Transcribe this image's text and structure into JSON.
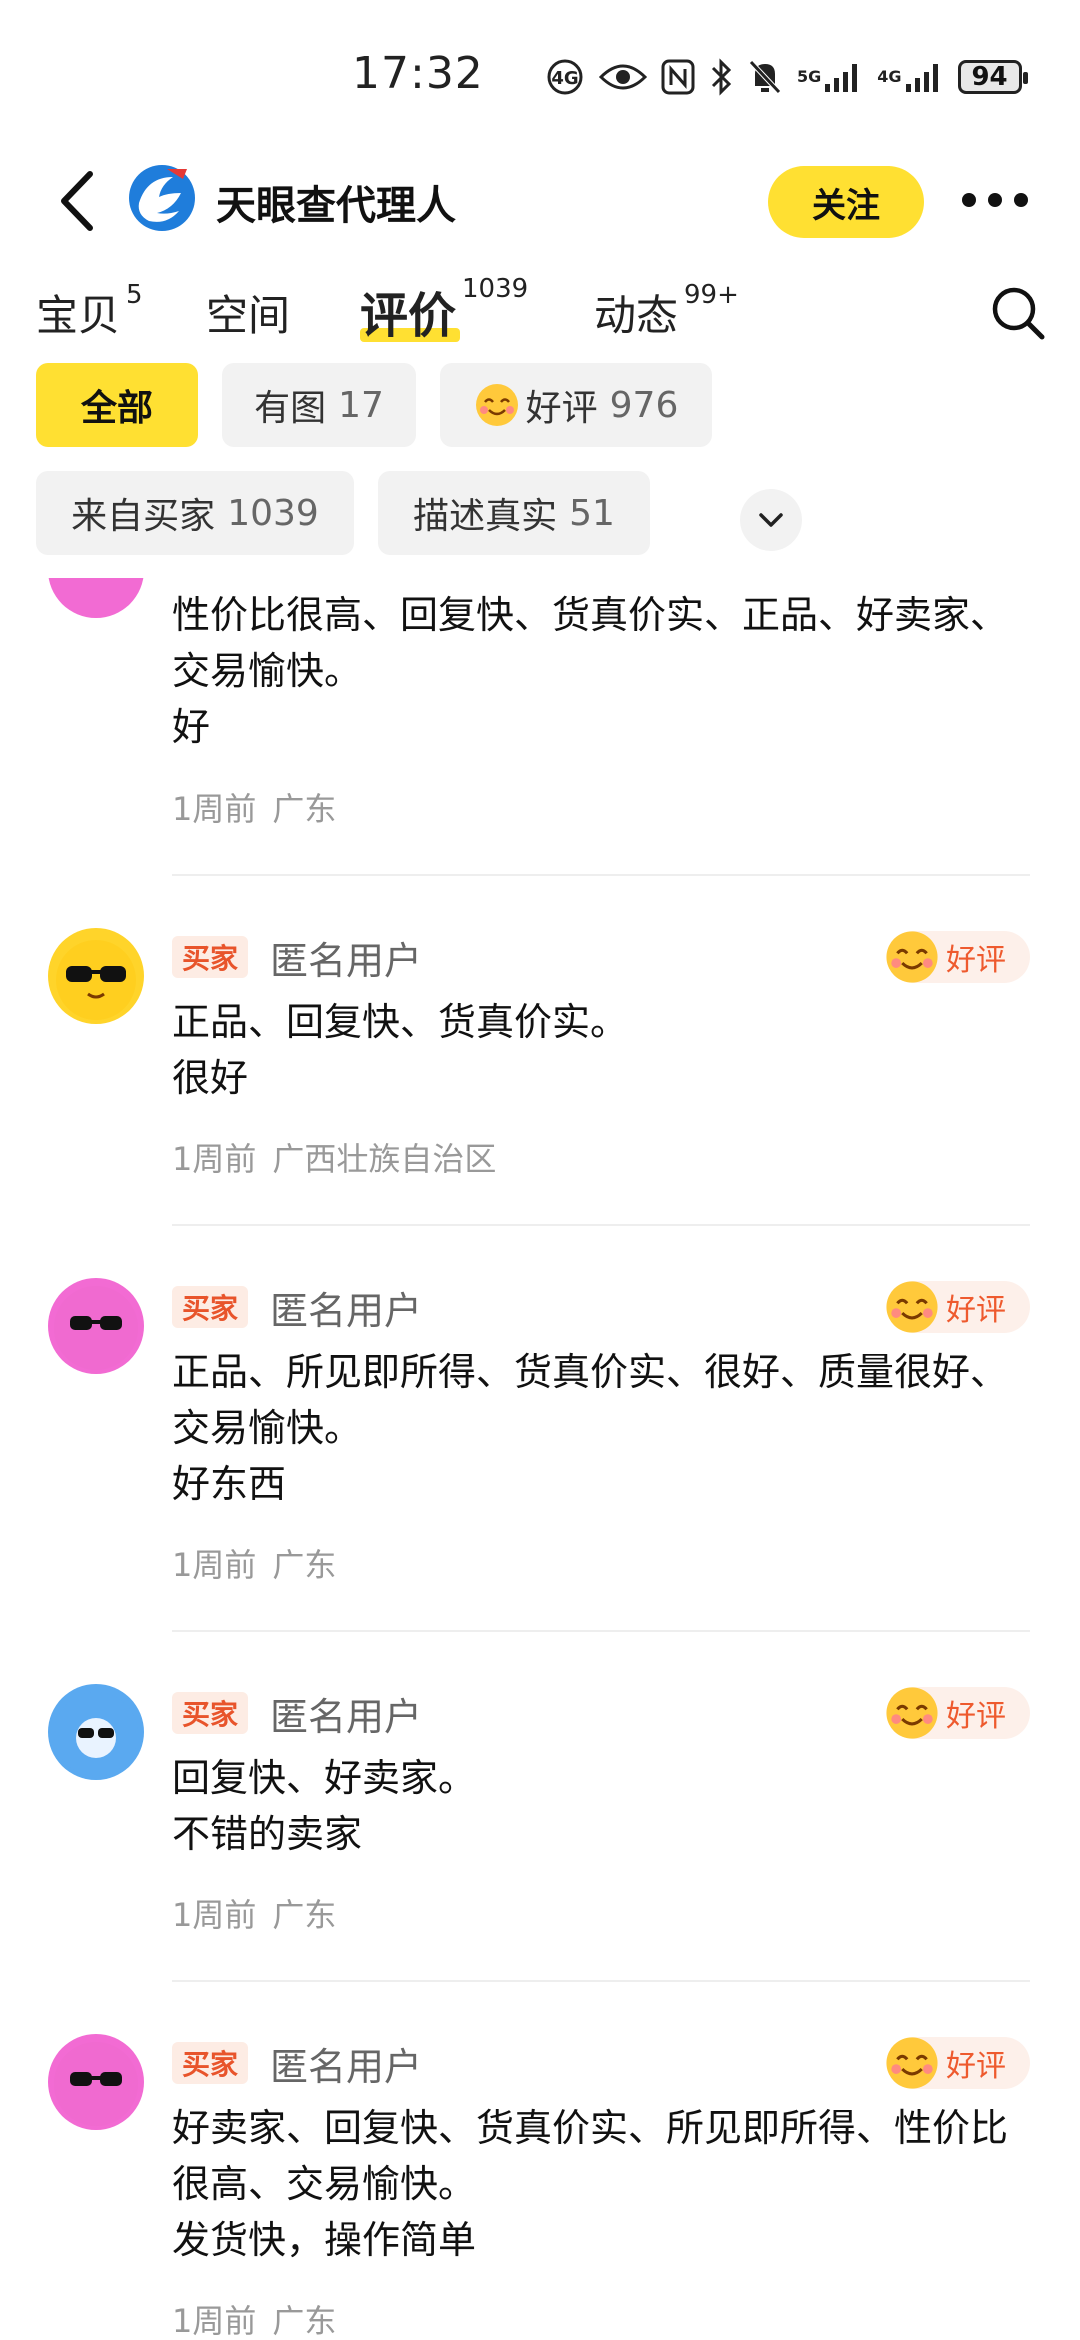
{
  "status_bar": {
    "time": "17:32",
    "battery": "94",
    "net1": "5G",
    "net2": "4G"
  },
  "header": {
    "shop_name": "天眼查代理人",
    "follow_label": "关注"
  },
  "tabs": [
    {
      "label": "宝贝",
      "count": "5"
    },
    {
      "label": "空间",
      "count": ""
    },
    {
      "label": "评价",
      "count": "1039"
    },
    {
      "label": "动态",
      "count": "99+"
    }
  ],
  "filters": [
    {
      "label": "全部",
      "count": ""
    },
    {
      "label": "有图",
      "count": "17"
    },
    {
      "label": "好评",
      "count": "976"
    },
    {
      "label": "来自买家",
      "count": "1039"
    },
    {
      "label": "描述真实",
      "count": "51"
    }
  ],
  "reviews": [
    {
      "tag": "",
      "user": "",
      "rating": "",
      "lines": [
        "性价比很高、回复快、货真价实、正品、好卖家、交易愉快。",
        "好"
      ],
      "time": "1周前",
      "location": "广东",
      "avatar_color": "#f26bd3"
    },
    {
      "tag": "买家",
      "user": "匿名用户",
      "rating": "好评",
      "lines": [
        "正品、回复快、货真价实。",
        "很好"
      ],
      "time": "1周前",
      "location": "广西壮族自治区",
      "avatar_color": "#ffd42a"
    },
    {
      "tag": "买家",
      "user": "匿名用户",
      "rating": "好评",
      "lines": [
        "正品、所见即所得、货真价实、很好、质量很好、交易愉快。",
        "好东西"
      ],
      "time": "1周前",
      "location": "广东",
      "avatar_color": "#f26bd3"
    },
    {
      "tag": "买家",
      "user": "匿名用户",
      "rating": "好评",
      "lines": [
        "回复快、好卖家。",
        "不错的卖家"
      ],
      "time": "1周前",
      "location": "广东",
      "avatar_color": "#5aa9f0"
    },
    {
      "tag": "买家",
      "user": "匿名用户",
      "rating": "好评",
      "lines": [
        "好卖家、回复快、货真价实、所见即所得、性价比很高、交易愉快。",
        "发货快，操作简单"
      ],
      "time": "1周前",
      "location": "广东",
      "avatar_color": "#f26bd3"
    }
  ]
}
